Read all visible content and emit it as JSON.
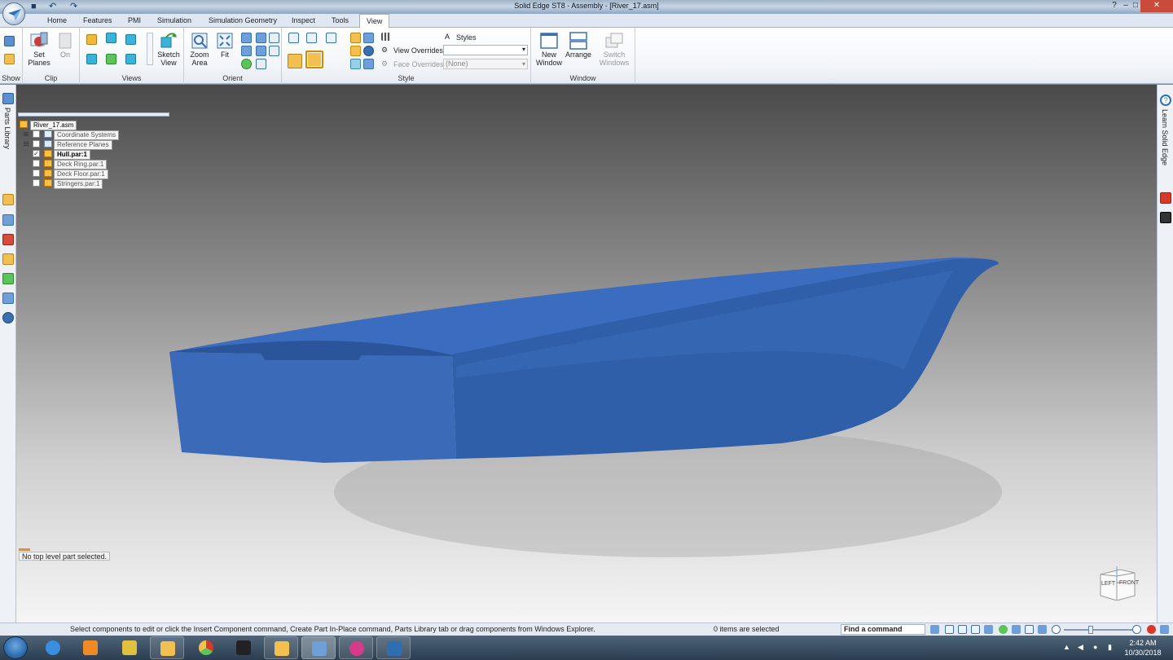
{
  "window": {
    "title": "Solid Edge ST8 - Assembly - [River_17.asm]",
    "controls": {
      "minimize": "–",
      "maximize": "□",
      "close": "✕"
    }
  },
  "quick_access": {
    "save": "save-icon",
    "undo": "↶",
    "redo": "↷"
  },
  "tabs": [
    "Home",
    "Features",
    "PMI",
    "Simulation",
    "Simulation Geometry",
    "Inspect",
    "Tools",
    "View"
  ],
  "active_tab": "View",
  "ribbon": {
    "show": {
      "label": "Show"
    },
    "clip": {
      "label": "Clip",
      "set_planes": "Set Planes",
      "on": "On"
    },
    "views": {
      "label": "Views",
      "sketch_view": "Sketch View"
    },
    "orient": {
      "label": "Orient",
      "zoom_area": "Zoom Area",
      "fit": "Fit"
    },
    "style": {
      "label": "Style",
      "styles": "Styles",
      "view_overrides": "View Overrides",
      "view_overrides_value": "",
      "face_overrides": "Face Overrides",
      "face_overrides_value": "(None)"
    },
    "window": {
      "label": "Window",
      "new_window": "New Window",
      "arrange": "Arrange",
      "switch_windows": "Switch Windows"
    }
  },
  "left_dock": {
    "parts_library": "Parts Library"
  },
  "right_dock": {
    "learn": "Learn Solid Edge",
    "youtube": "You Tube"
  },
  "tree": {
    "root": "River_17.asm",
    "items": [
      {
        "label": "Coordinate Systems",
        "checked": false,
        "expandable": true
      },
      {
        "label": "Reference Planes",
        "checked": false,
        "expandable": true
      },
      {
        "label": "Hull.par:1",
        "checked": true,
        "expandable": false,
        "active": true
      },
      {
        "label": "Deck Ring.par:1",
        "checked": false,
        "expandable": false
      },
      {
        "label": "Deck Floor.par:1",
        "checked": false,
        "expandable": false
      },
      {
        "label": "Stringers.par:1",
        "checked": false,
        "expandable": false
      }
    ]
  },
  "prompt": "No top level part selected.",
  "viewcube": {
    "left": "LEFT",
    "front": "FRONT"
  },
  "status": {
    "message": "Select components to edit or click the Insert Component command, Create Part In-Place command, Parts Library tab or drag components from Windows Explorer.",
    "selection": "0 items are selected",
    "find_command": "Find a command"
  },
  "taskbar": {
    "apps": [
      "internet-explorer",
      "media-player",
      "solid-edge-launcher",
      "file-explorer",
      "chrome",
      "fitness-app",
      "security-shield",
      "solid-edge",
      "itunes",
      "document-app"
    ],
    "time": "2:42 AM",
    "date": "10/30/2018"
  },
  "colors": {
    "hull": "#2f5fa8",
    "hull_dark": "#2a559a",
    "hull_top": "#3a6cc0",
    "accent": "#f08a24"
  }
}
